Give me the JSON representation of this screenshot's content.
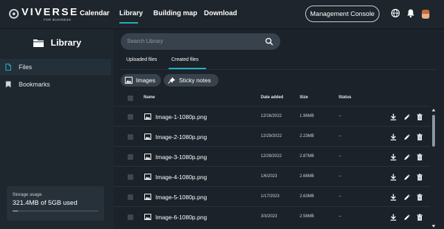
{
  "logo": {
    "text": "VIVERSE",
    "subtext": "FOR BUSINESS"
  },
  "nav": {
    "items": [
      "Calendar",
      "Library",
      "Building map",
      "Download"
    ],
    "active": "Library"
  },
  "header": {
    "console_button": "Management Console",
    "icons": [
      "globe-icon",
      "bell-icon",
      "avatar"
    ]
  },
  "sidebar": {
    "title": "Library",
    "items": [
      {
        "label": "Files",
        "icon": "file-icon",
        "active": true
      },
      {
        "label": "Bookmarks",
        "icon": "bookmark-icon",
        "active": false
      }
    ],
    "storage": {
      "label": "Storage usage",
      "value": "321.4MB of 5GB used",
      "fraction": 0.063
    }
  },
  "search": {
    "placeholder": "Search Library"
  },
  "tabs": [
    {
      "label": "Uploaded files",
      "active": false
    },
    {
      "label": "Created files",
      "active": true
    }
  ],
  "filters": [
    {
      "label": "Images",
      "icon": "image-icon"
    },
    {
      "label": "Sticky notes",
      "icon": "pin-icon"
    }
  ],
  "table": {
    "columns": [
      "Name",
      "Date added",
      "Size",
      "Status"
    ],
    "rows": [
      {
        "name": "Image-1-1080p.png",
        "date": "12/16/2022",
        "size": "1.96MB",
        "status": "--"
      },
      {
        "name": "Image-2-1080p.png",
        "date": "12/29/2022",
        "size": "2.23MB",
        "status": "--"
      },
      {
        "name": "Image-3-1080p.png",
        "date": "12/29/2022",
        "size": "2.87MB",
        "status": "--"
      },
      {
        "name": "Image-4-1080p.png",
        "date": "1/6/2023",
        "size": "2.68MB",
        "status": "--"
      },
      {
        "name": "Image-5-1080p.png",
        "date": "1/17/2023",
        "size": "2.63MB",
        "status": "--"
      },
      {
        "name": "Image-6-1080p.png",
        "date": "3/3/2023",
        "size": "2.58MB",
        "status": "--"
      }
    ],
    "row_actions": [
      "download-icon",
      "edit-icon",
      "delete-icon"
    ]
  },
  "colors": {
    "accent": "#21b5c8",
    "background": "#1b2229",
    "sidebar": "#1e262e",
    "chip": "#38424c"
  }
}
